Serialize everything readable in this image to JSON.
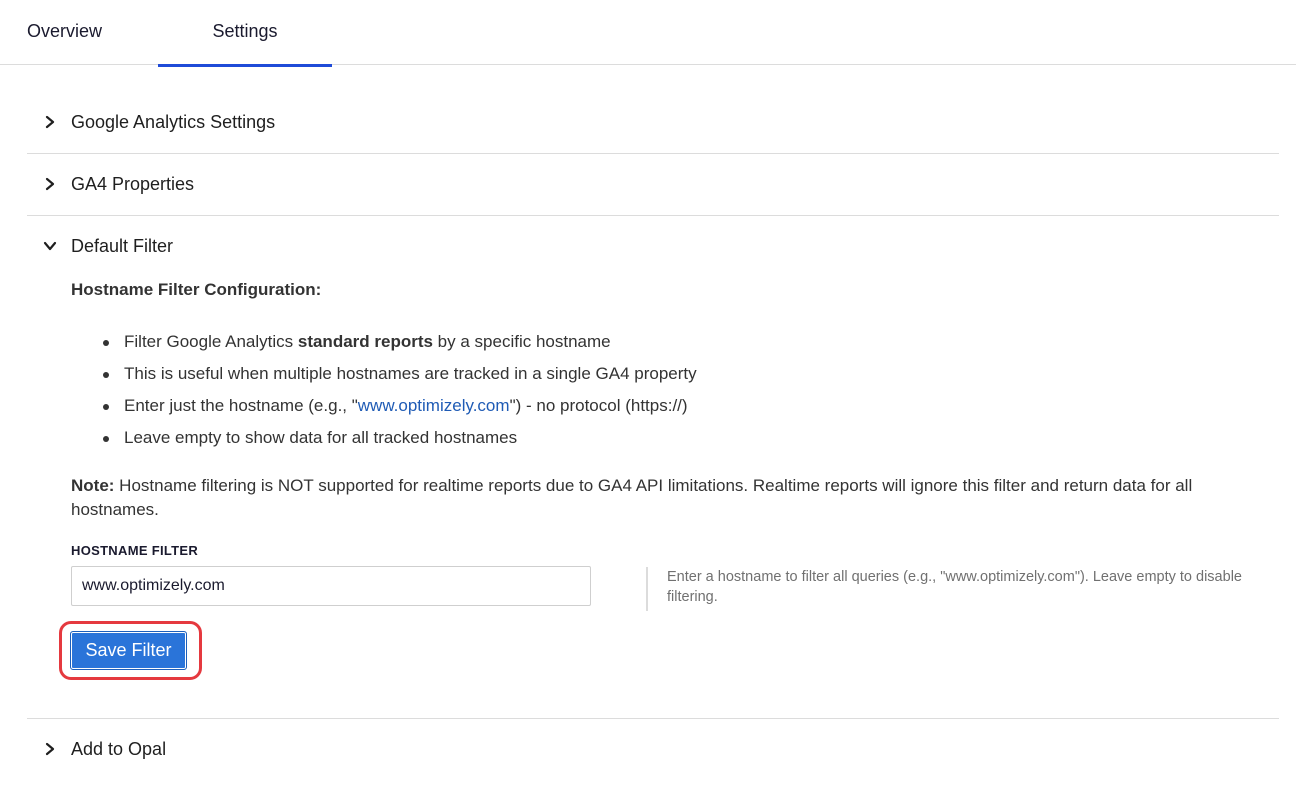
{
  "tabs": [
    {
      "label": "Overview"
    },
    {
      "label": "Settings",
      "active": true
    }
  ],
  "sections": [
    {
      "title": "Google Analytics Settings",
      "expanded": false
    },
    {
      "title": "GA4 Properties",
      "expanded": false
    },
    {
      "title": "Default Filter",
      "expanded": true
    },
    {
      "title": "Add to Opal",
      "expanded": false
    }
  ],
  "default_filter": {
    "config_heading": "Hostname Filter Configuration:",
    "bullets": {
      "b1_pre": "Filter Google Analytics ",
      "b1_bold": "standard reports",
      "b1_post": " by a specific hostname",
      "b2": "This is useful when multiple hostnames are tracked in a single GA4 property",
      "b3_pre": "Enter just the hostname (e.g., \"",
      "b3_link": "www.optimizely.com",
      "b3_post": "\") - no protocol (https://)",
      "b4": "Leave empty to show data for all tracked hostnames"
    },
    "note_label": "Note:",
    "note_text": " Hostname filtering is NOT supported for realtime reports due to GA4 API limitations. Realtime reports will ignore this filter and return data for all hostnames.",
    "field_label": "HOSTNAME FILTER",
    "field_value": "www.optimizely.com",
    "help_text": "Enter a hostname to filter all queries (e.g., \"www.optimizely.com\"). Leave empty to disable filtering.",
    "save_label": "Save Filter"
  },
  "colors": {
    "accent": "#1f4bd8",
    "button": "#2a74d9",
    "highlight": "#e5393f",
    "link": "#1f5bb5"
  },
  "icons": {
    "collapsed": "chevron-right-icon",
    "expanded": "chevron-down-icon"
  }
}
